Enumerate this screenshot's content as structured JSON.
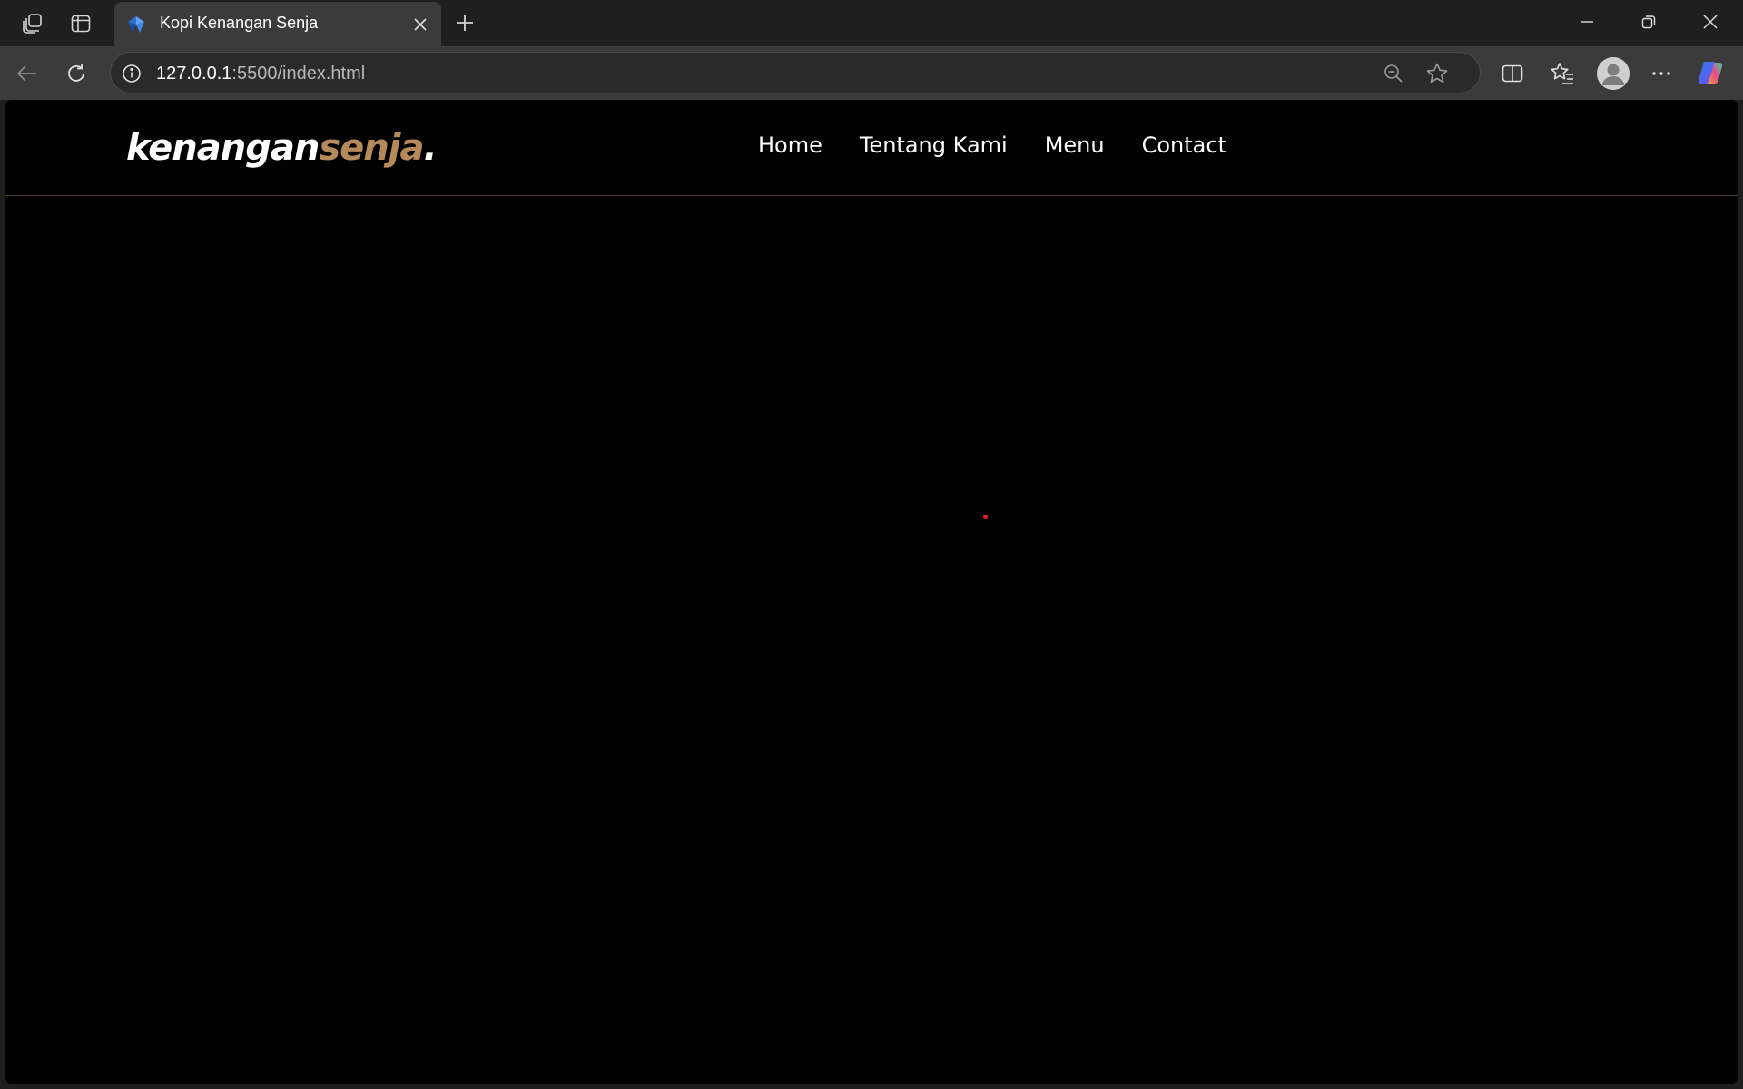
{
  "browser": {
    "tab": {
      "title": "Kopi Kenangan Senja"
    },
    "address": {
      "host": "127.0.0.1",
      "rest": ":5500/index.html"
    },
    "icons": {
      "workspaces": "workspaces-icon",
      "tab_actions": "tab-actions-icon",
      "close_tab": "close-icon",
      "new_tab": "plus-icon",
      "back": "back-arrow-icon",
      "refresh": "refresh-icon",
      "site_info": "info-icon",
      "zoom": "zoom-out-icon",
      "favorite": "star-icon",
      "split_screen": "split-screen-icon",
      "favorites": "favorites-icon",
      "profile": "profile-icon",
      "more": "more-icon",
      "copilot": "copilot-icon"
    }
  },
  "site": {
    "logo": {
      "part1": "kenangan",
      "part2": "senja",
      "dot": "."
    },
    "nav": [
      "Home",
      "Tentang Kami",
      "Menu",
      "Contact"
    ],
    "colors": {
      "background": "#010101",
      "accent": "#b6895b",
      "text": "#ffffff"
    }
  }
}
